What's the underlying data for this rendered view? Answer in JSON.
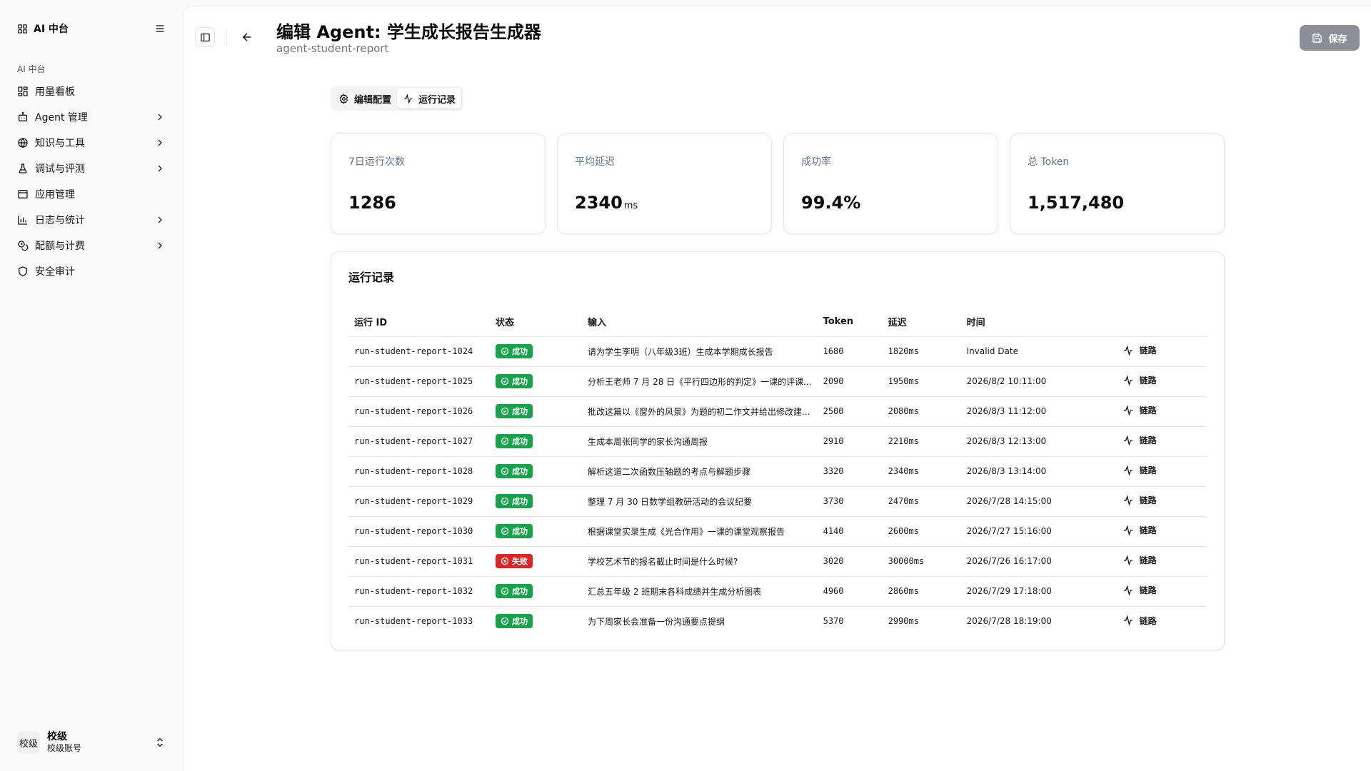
{
  "sidebar": {
    "brand": "AI 中台",
    "group_label": "AI 中台",
    "items": [
      {
        "label": "用量看板",
        "icon": "dashboard-icon",
        "has_children": false
      },
      {
        "label": "Agent 管理",
        "icon": "bot-icon",
        "has_children": true
      },
      {
        "label": "知识与工具",
        "icon": "globe-icon",
        "has_children": true
      },
      {
        "label": "调试与评测",
        "icon": "flask-icon",
        "has_children": true
      },
      {
        "label": "应用管理",
        "icon": "app-window-icon",
        "has_children": false
      },
      {
        "label": "日志与统计",
        "icon": "bar-chart-icon",
        "has_children": true
      },
      {
        "label": "配额与计费",
        "icon": "coins-icon",
        "has_children": true
      },
      {
        "label": "安全审计",
        "icon": "shield-icon",
        "has_children": false
      }
    ],
    "account": {
      "avatar": "校级",
      "name": "校级",
      "subtitle": "校级账号"
    }
  },
  "header": {
    "title": "编辑 Agent: 学生成长报告生成器",
    "subtitle": "agent-student-report",
    "save_label": "保存"
  },
  "tabs": [
    {
      "label": "编辑配置",
      "icon": "gear-icon",
      "active": false
    },
    {
      "label": "运行记录",
      "icon": "activity-icon",
      "active": true
    }
  ],
  "stats": [
    {
      "label": "7日运行次数",
      "value": "1286",
      "unit": ""
    },
    {
      "label": "平均延迟",
      "value": "2340",
      "unit": "ms"
    },
    {
      "label": "成功率",
      "value": "99.4%",
      "unit": ""
    },
    {
      "label": "总 Token",
      "value": "1,517,480",
      "unit": ""
    }
  ],
  "runs": {
    "title": "运行记录",
    "columns": [
      "运行 ID",
      "状态",
      "输入",
      "Token",
      "延迟",
      "时间",
      ""
    ],
    "rows": [
      {
        "id": "run-student-report-1024",
        "status": "成功",
        "ok": true,
        "input": "请为学生李明（八年级3班）生成本学期成长报告",
        "token": "1680",
        "latency": "1820ms",
        "time": "Invalid Date",
        "link": "链路"
      },
      {
        "id": "run-student-report-1025",
        "status": "成功",
        "ok": true,
        "input": "分析王老师 7 月 28 日《平行四边形的判定》一课的评课...",
        "token": "2090",
        "latency": "1950ms",
        "time": "2026/8/2 10:11:00",
        "link": "链路"
      },
      {
        "id": "run-student-report-1026",
        "status": "成功",
        "ok": true,
        "input": "批改这篇以《窗外的风景》为题的初二作文并给出修改建...",
        "token": "2500",
        "latency": "2080ms",
        "time": "2026/8/3 11:12:00",
        "link": "链路"
      },
      {
        "id": "run-student-report-1027",
        "status": "成功",
        "ok": true,
        "input": "生成本周张同学的家长沟通周报",
        "token": "2910",
        "latency": "2210ms",
        "time": "2026/8/3 12:13:00",
        "link": "链路"
      },
      {
        "id": "run-student-report-1028",
        "status": "成功",
        "ok": true,
        "input": "解析这道二次函数压轴题的考点与解题步骤",
        "token": "3320",
        "latency": "2340ms",
        "time": "2026/8/3 13:14:00",
        "link": "链路"
      },
      {
        "id": "run-student-report-1029",
        "status": "成功",
        "ok": true,
        "input": "整理 7 月 30 日数学组教研活动的会议纪要",
        "token": "3730",
        "latency": "2470ms",
        "time": "2026/7/28 14:15:00",
        "link": "链路"
      },
      {
        "id": "run-student-report-1030",
        "status": "成功",
        "ok": true,
        "input": "根据课堂实录生成《光合作用》一课的课堂观察报告",
        "token": "4140",
        "latency": "2600ms",
        "time": "2026/7/27 15:16:00",
        "link": "链路"
      },
      {
        "id": "run-student-report-1031",
        "status": "失败",
        "ok": false,
        "input": "学校艺术节的报名截止时间是什么时候?",
        "token": "3020",
        "latency": "30000ms",
        "time": "2026/7/26 16:17:00",
        "link": "链路"
      },
      {
        "id": "run-student-report-1032",
        "status": "成功",
        "ok": true,
        "input": "汇总五年级 2 班期末各科成绩并生成分析图表",
        "token": "4960",
        "latency": "2860ms",
        "time": "2026/7/29 17:18:00",
        "link": "链路"
      },
      {
        "id": "run-student-report-1033",
        "status": "成功",
        "ok": true,
        "input": "为下周家长会准备一份沟通要点提纲",
        "token": "5370",
        "latency": "2990ms",
        "time": "2026/7/28 18:19:00",
        "link": "链路"
      }
    ]
  },
  "colors": {
    "success": "#16a34a",
    "fail": "#dc2626",
    "save_button": "#8a8f98"
  }
}
